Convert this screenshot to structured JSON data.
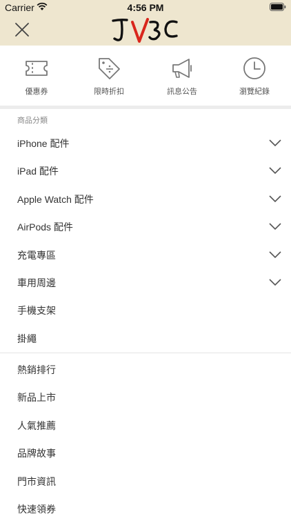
{
  "status_bar": {
    "carrier": "Carrier",
    "time": "4:56 PM"
  },
  "header": {
    "logo_text": "JV3C",
    "close_icon": "close-icon",
    "brand_red": "#d9261c",
    "background": "#eee6cf"
  },
  "quick_links": [
    {
      "label": "優惠券",
      "icon": "ticket-icon"
    },
    {
      "label": "限時折扣",
      "icon": "discount-tag-icon"
    },
    {
      "label": "訊息公告",
      "icon": "megaphone-icon"
    },
    {
      "label": "瀏覽紀錄",
      "icon": "clock-icon"
    }
  ],
  "category_section": {
    "title": "商品分類",
    "items": [
      {
        "label": "iPhone 配件",
        "expandable": true
      },
      {
        "label": "iPad 配件",
        "expandable": true
      },
      {
        "label": "Apple Watch 配件",
        "expandable": true
      },
      {
        "label": "AirPods 配件",
        "expandable": true
      },
      {
        "label": "充電專區",
        "expandable": true
      },
      {
        "label": "車用周邊",
        "expandable": true
      },
      {
        "label": "手機支架",
        "expandable": false
      },
      {
        "label": "掛繩",
        "expandable": false
      }
    ]
  },
  "other_links": [
    {
      "label": "熱銷排行"
    },
    {
      "label": "新品上市"
    },
    {
      "label": "人氣推薦"
    },
    {
      "label": "品牌故事"
    },
    {
      "label": "門市資訊"
    },
    {
      "label": "快速領券"
    }
  ]
}
